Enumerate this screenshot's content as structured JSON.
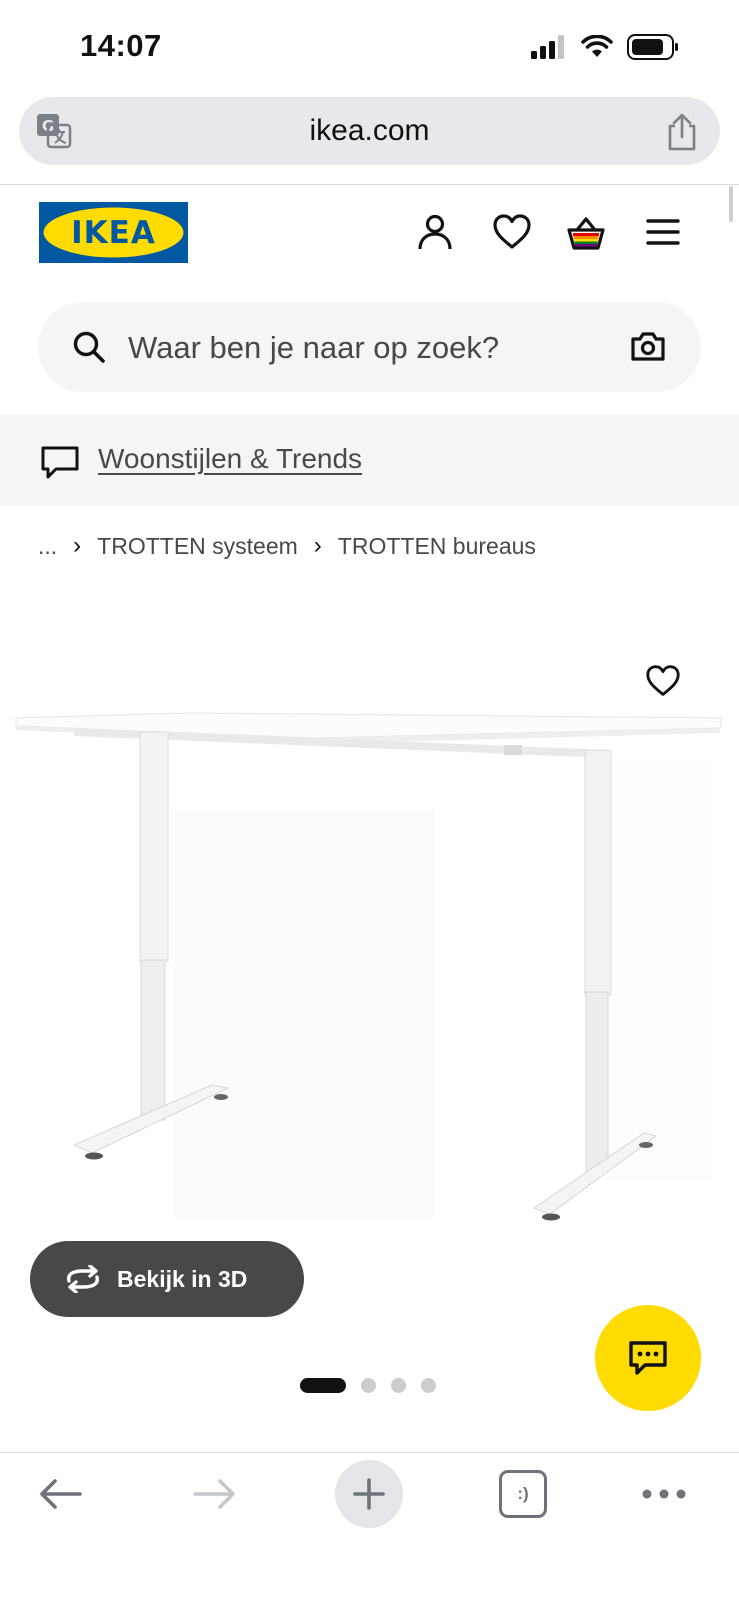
{
  "status": {
    "time": "14:07"
  },
  "browser": {
    "url": "ikea.com",
    "tab_face": ":)"
  },
  "header": {
    "logo_text": "IKEA"
  },
  "search": {
    "placeholder": "Waar ben je naar op zoek?"
  },
  "inspiration": {
    "link_label": "Woonstijlen & Trends"
  },
  "breadcrumb": {
    "items": [
      "...",
      "TROTTEN systeem",
      "TROTTEN bureaus"
    ]
  },
  "product": {
    "view_3d_label": "Bekijk in 3D",
    "image_count": 4,
    "active_image": 1
  },
  "colors": {
    "ikea_blue": "#0058a3",
    "ikea_yellow": "#ffdb00",
    "button_dark": "#484848"
  },
  "icons": [
    "translate-icon",
    "share-icon",
    "account-icon",
    "heart-icon",
    "basket-icon",
    "menu-icon",
    "search-icon",
    "camera-icon",
    "chat-bubble-icon",
    "rotate-icon",
    "chat-icon",
    "back-arrow-icon",
    "forward-arrow-icon",
    "plus-icon",
    "more-icon"
  ]
}
